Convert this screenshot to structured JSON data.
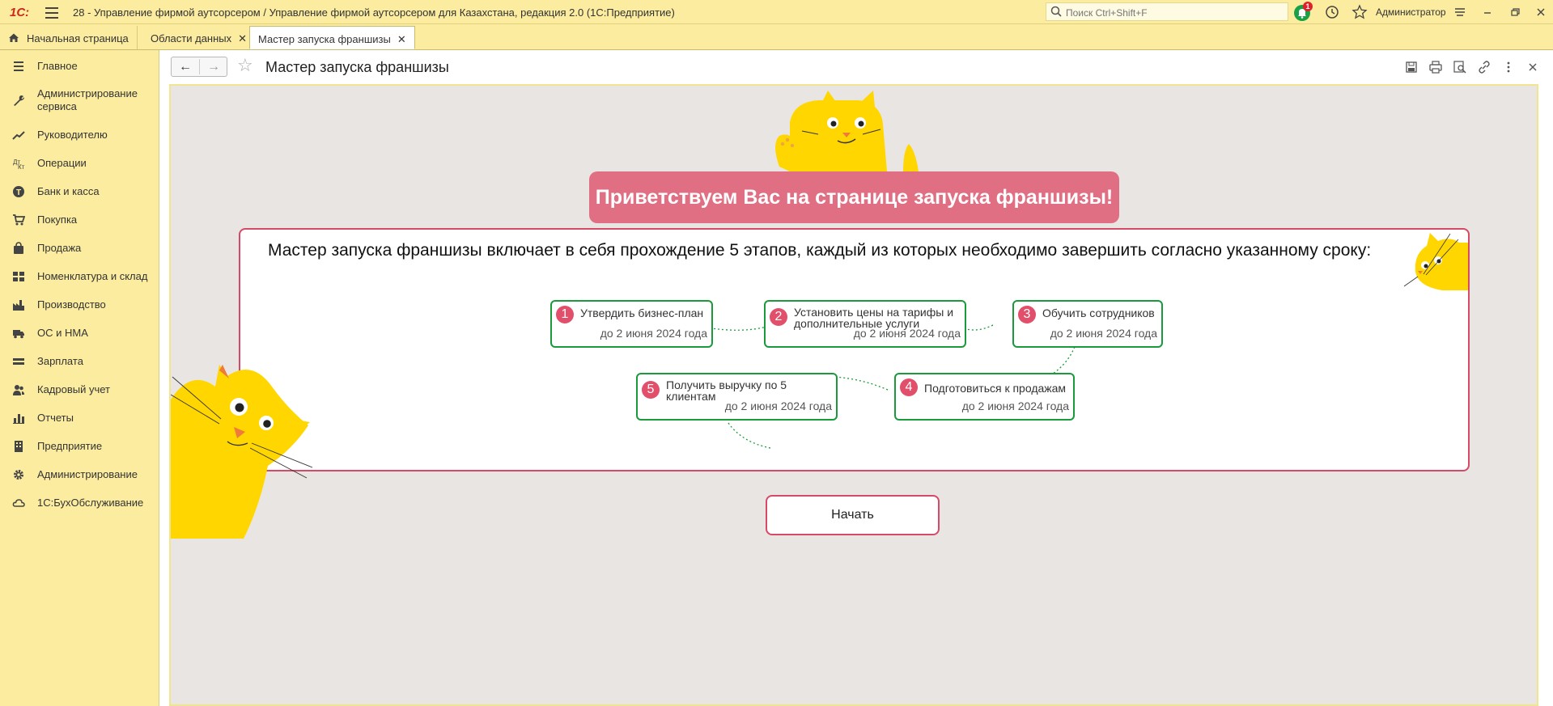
{
  "app": {
    "logo": "1С:",
    "title": "28 - Управление фирмой аутсорсером / Управление фирмой аутсорсером для Казахстана, редакция 2.0  (1С:Предприятие)",
    "search_placeholder": "Поиск Ctrl+Shift+F",
    "notifications_count": "1",
    "user": "Администратор"
  },
  "tabs": [
    {
      "label": "Начальная страница"
    },
    {
      "label": "Области данных"
    },
    {
      "label": "Мастер запуска франшизы"
    }
  ],
  "tab_close": "✕",
  "sidebar": {
    "items": [
      {
        "label": "Главное",
        "icon": "menu-icon"
      },
      {
        "label": "Администрирование сервиса",
        "icon": "wrench-icon"
      },
      {
        "label": "Руководителю",
        "icon": "trend-chart-icon"
      },
      {
        "label": "Операции",
        "icon": "operations-icon"
      },
      {
        "label": "Банк и касса",
        "icon": "bank-icon"
      },
      {
        "label": "Покупка",
        "icon": "cart-icon"
      },
      {
        "label": "Продажа",
        "icon": "bag-icon"
      },
      {
        "label": "Номенклатура и склад",
        "icon": "grid-icon"
      },
      {
        "label": "Производство",
        "icon": "factory-icon"
      },
      {
        "label": "ОС и НМА",
        "icon": "truck-icon"
      },
      {
        "label": "Зарплата",
        "icon": "money-icon"
      },
      {
        "label": "Кадровый учет",
        "icon": "people-icon"
      },
      {
        "label": "Отчеты",
        "icon": "bar-chart-icon"
      },
      {
        "label": "Предприятие",
        "icon": "building-icon"
      },
      {
        "label": "Администрирование",
        "icon": "gear-icon"
      },
      {
        "label": "1С:БухОбслуживание",
        "icon": "cloud-icon"
      }
    ]
  },
  "page": {
    "title": "Мастер запуска франшизы"
  },
  "wizard": {
    "welcome": "Приветствуем Вас на странице запуска франшизы!",
    "intro": "Мастер запуска франшизы включает в себя прохождение 5 этапов, каждый из которых необходимо завершить согласно указанному сроку:",
    "steps": [
      {
        "num": "1",
        "title": "Утвердить бизнес-план",
        "due": "до 2 июня 2024 года"
      },
      {
        "num": "2",
        "title": "Установить цены на тарифы и дополнительные услуги",
        "due": "до 2 июня 2024 года"
      },
      {
        "num": "3",
        "title": "Обучить сотрудников",
        "due": "до 2 июня 2024 года"
      },
      {
        "num": "4",
        "title": "Подготовиться к продажам",
        "due": "до 2 июня 2024 года"
      },
      {
        "num": "5",
        "title": "Получить выручку по 5 клиентам",
        "due": "до 2 июня 2024 года"
      }
    ],
    "start_button": "Начать"
  },
  "colors": {
    "chrome": "#fbeca0",
    "accent_pink": "#e16f84",
    "border_pink": "#d64a67",
    "step_green": "#1a9a3a",
    "cat_yellow": "#ffd600"
  }
}
